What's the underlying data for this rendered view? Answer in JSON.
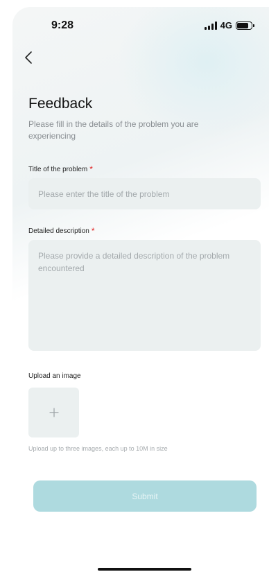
{
  "status_bar": {
    "time": "9:28",
    "network": "4G",
    "icons": [
      "signal-icon",
      "battery-icon"
    ]
  },
  "nav": {
    "back_icon": "chevron-left-icon"
  },
  "header": {
    "title": "Feedback",
    "subtitle": "Please fill in the details of the problem you are experiencing"
  },
  "form": {
    "title_field": {
      "label": "Title of the problem",
      "required_mark": "*",
      "value": "",
      "placeholder": "Please enter the title of the problem"
    },
    "description_field": {
      "label": "Detailed description",
      "required_mark": "*",
      "value": "",
      "placeholder": "Please provide a detailed description of the problem encountered"
    },
    "upload": {
      "label": "Upload an image",
      "add_icon": "plus-icon",
      "hint": "Upload up to three images, each up to 10M in size"
    },
    "submit_label": "Submit"
  },
  "colors": {
    "accent": "#aedadf",
    "field_bg": "#ebf0f0",
    "required": "#e02020"
  }
}
